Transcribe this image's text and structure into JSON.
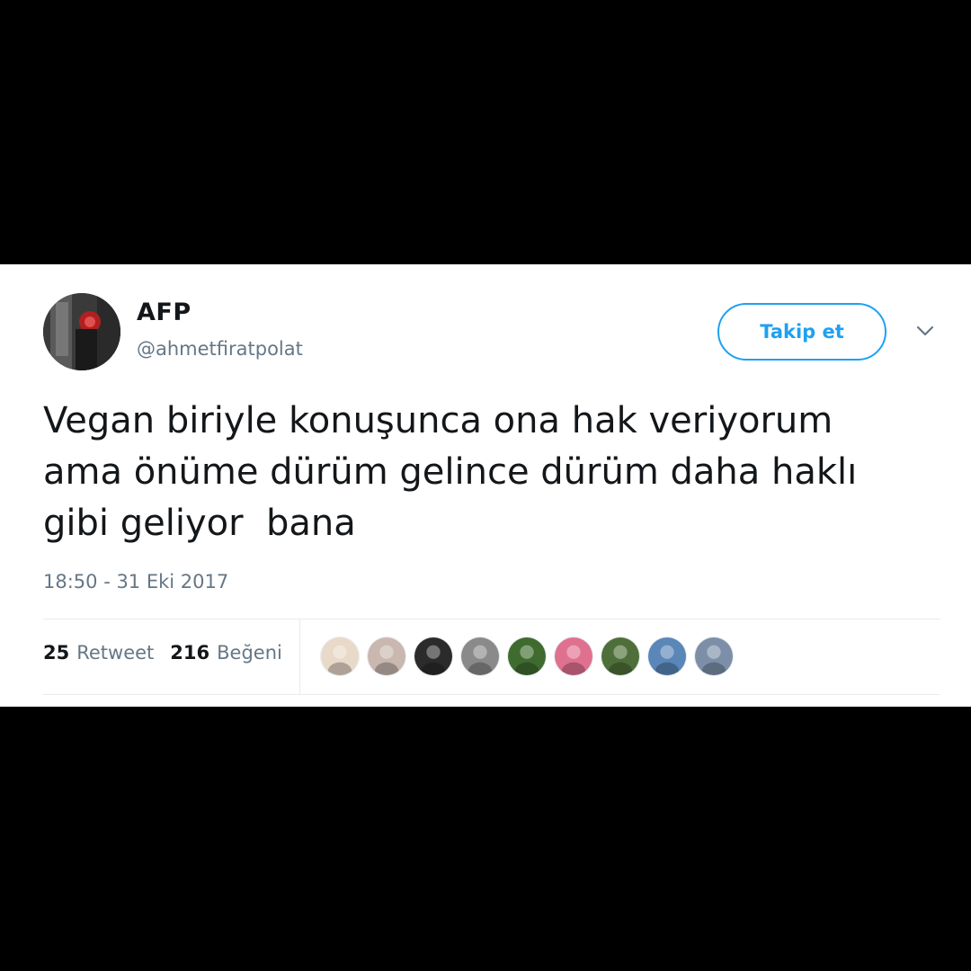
{
  "author": {
    "display_name": "AFP",
    "handle": "@ahmetfiratpolat"
  },
  "follow_button": {
    "label": "Takip et"
  },
  "menu_icon": "chevron-down-icon",
  "tweet": {
    "text": "Vegan biriyle konuşunca ona hak veriyorum\nama önüme dürüm gelince dürüm daha haklı\ngibi geliyor  bana",
    "timestamp": "18:50 - 31 Eki 2017"
  },
  "stats": {
    "retweets_count": "25",
    "retweets_label": "Retweet",
    "likes_count": "216",
    "likes_label": "Beğeni"
  },
  "likers": [
    {
      "color": "#e8d9c8"
    },
    {
      "color": "#c9b7b0"
    },
    {
      "color": "#2b2b2b"
    },
    {
      "color": "#8a8a8a"
    },
    {
      "color": "#3f6b2f"
    },
    {
      "color": "#e07090"
    },
    {
      "color": "#4f6f3a"
    },
    {
      "color": "#5a86b8"
    },
    {
      "color": "#7d8fa8"
    }
  ],
  "colors": {
    "accent": "#1da1f2",
    "text": "#14171a",
    "muted": "#657786"
  }
}
